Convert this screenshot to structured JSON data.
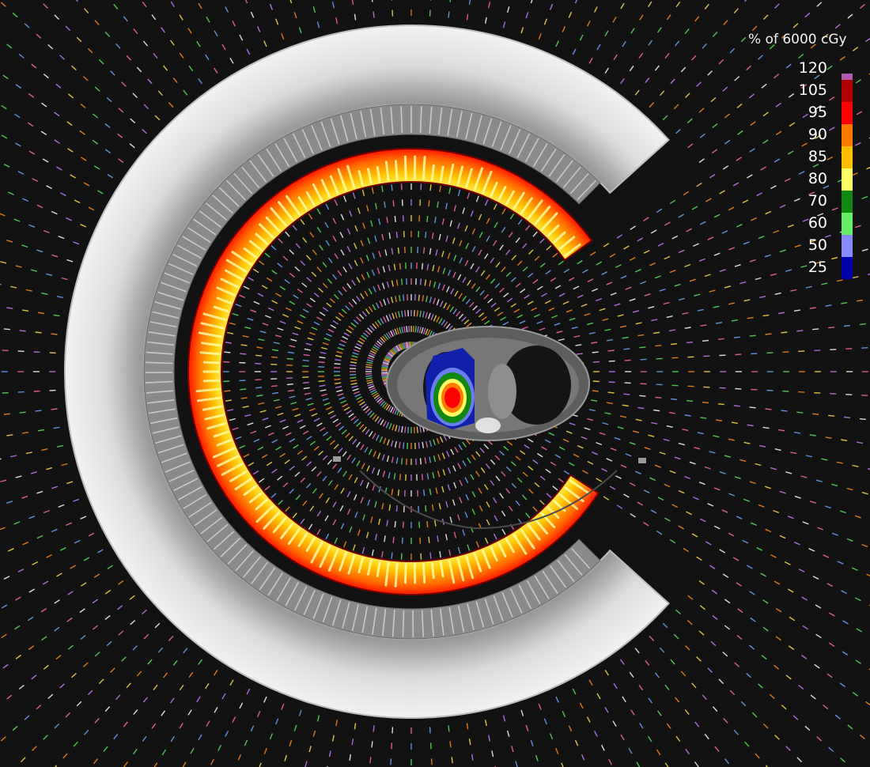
{
  "legend": {
    "title": "% of 6000 cGy",
    "levels": [
      {
        "label": "120",
        "color": "#b05cb0"
      },
      {
        "label": "105",
        "color": "#b00000"
      },
      {
        "label": "95",
        "color": "#ff0000"
      },
      {
        "label": "90",
        "color": "#ff7b00"
      },
      {
        "label": "85",
        "color": "#ffbf00"
      },
      {
        "label": "80",
        "color": "#ffff66"
      },
      {
        "label": "70",
        "color": "#118811"
      },
      {
        "label": "60",
        "color": "#66ee66"
      },
      {
        "label": "50",
        "color": "#8888ff"
      },
      {
        "label": "25",
        "color": "#0000aa"
      }
    ]
  },
  "scene": {
    "background_color": "#121212",
    "gantry_color": "#d8d8d8",
    "ray_colors": [
      "#ff69b4",
      "#6fa8ff",
      "#5be35b",
      "#ff8c1a",
      "#ffe14d",
      "#c77dff",
      "#ffffff"
    ]
  }
}
